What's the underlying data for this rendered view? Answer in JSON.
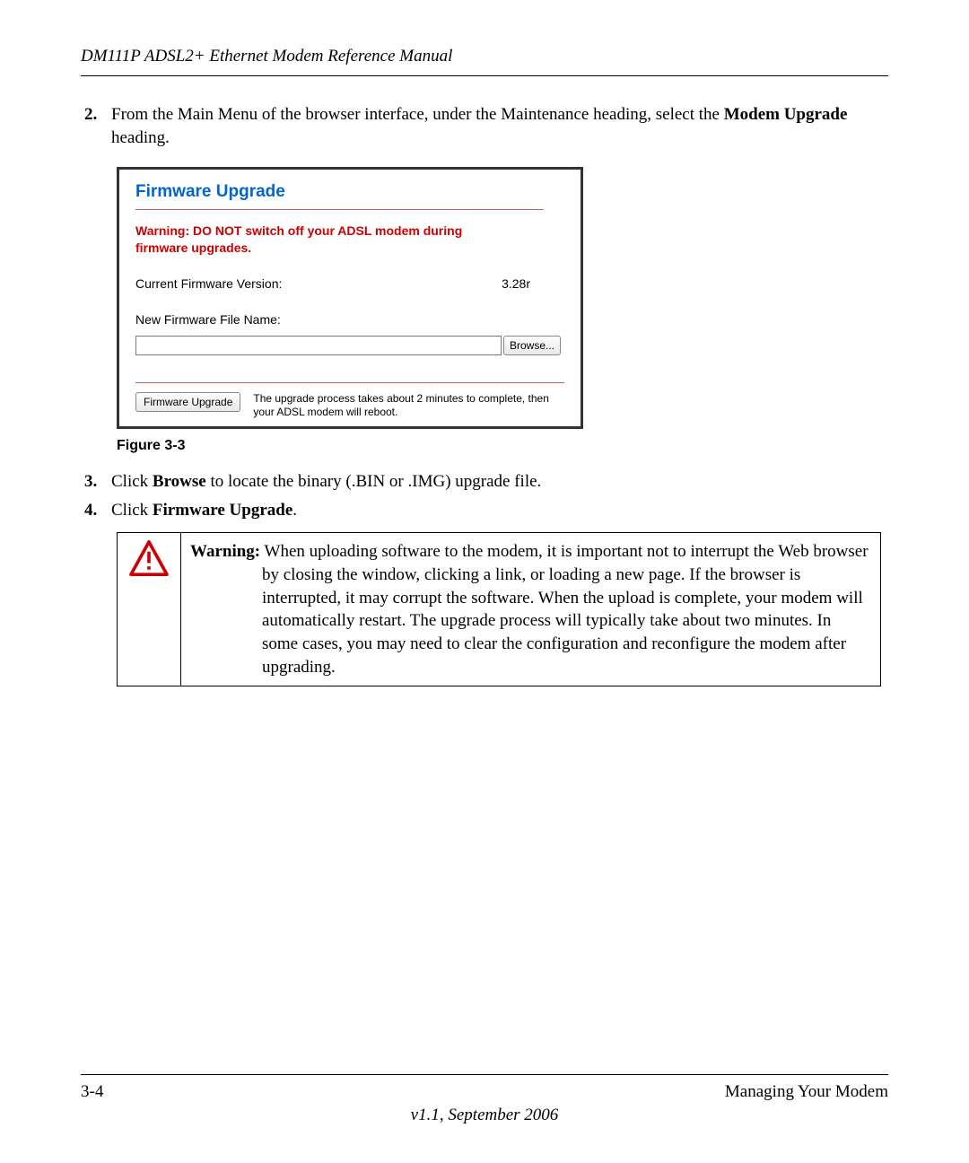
{
  "header": {
    "title": "DM111P ADSL2+ Ethernet Modem Reference Manual"
  },
  "steps": {
    "s2": {
      "num": "2.",
      "pre": "From the Main Menu of the browser interface, under the Maintenance heading, select the ",
      "bold": "Modem Upgrade",
      "post": " heading."
    },
    "s3": {
      "num": "3.",
      "pre": "Click ",
      "bold": "Browse",
      "post": " to locate the binary (.BIN or .IMG) upgrade file."
    },
    "s4": {
      "num": "4.",
      "pre": "Click ",
      "bold": "Firmware Upgrade",
      "post": "."
    }
  },
  "screenshot": {
    "title": "Firmware Upgrade",
    "warning": "Warning: DO NOT switch off your ADSL modem during firmware upgrades.",
    "current_version_label": "Current Firmware Version:",
    "current_version_value": "3.28r",
    "new_file_label": "New Firmware File Name:",
    "browse_btn": "Browse...",
    "upgrade_btn": "Firmware Upgrade",
    "footer_text": "The upgrade process takes about 2 minutes to complete, then your ADSL modem will reboot."
  },
  "figure_caption": "Figure 3-3",
  "warning_box": {
    "label": "Warning:",
    "body": " When uploading software to the modem, it is important not to interrupt the Web browser by closing the window, clicking a link, or loading a new page. If the browser is interrupted, it may corrupt the software. When the upload is complete, your modem will automatically restart. The upgrade process will typically take about two minutes. In some cases, you may need to clear the configuration and reconfigure the modem after upgrading."
  },
  "footer": {
    "page_num": "3-4",
    "section": "Managing Your Modem",
    "version": "v1.1, September 2006"
  }
}
